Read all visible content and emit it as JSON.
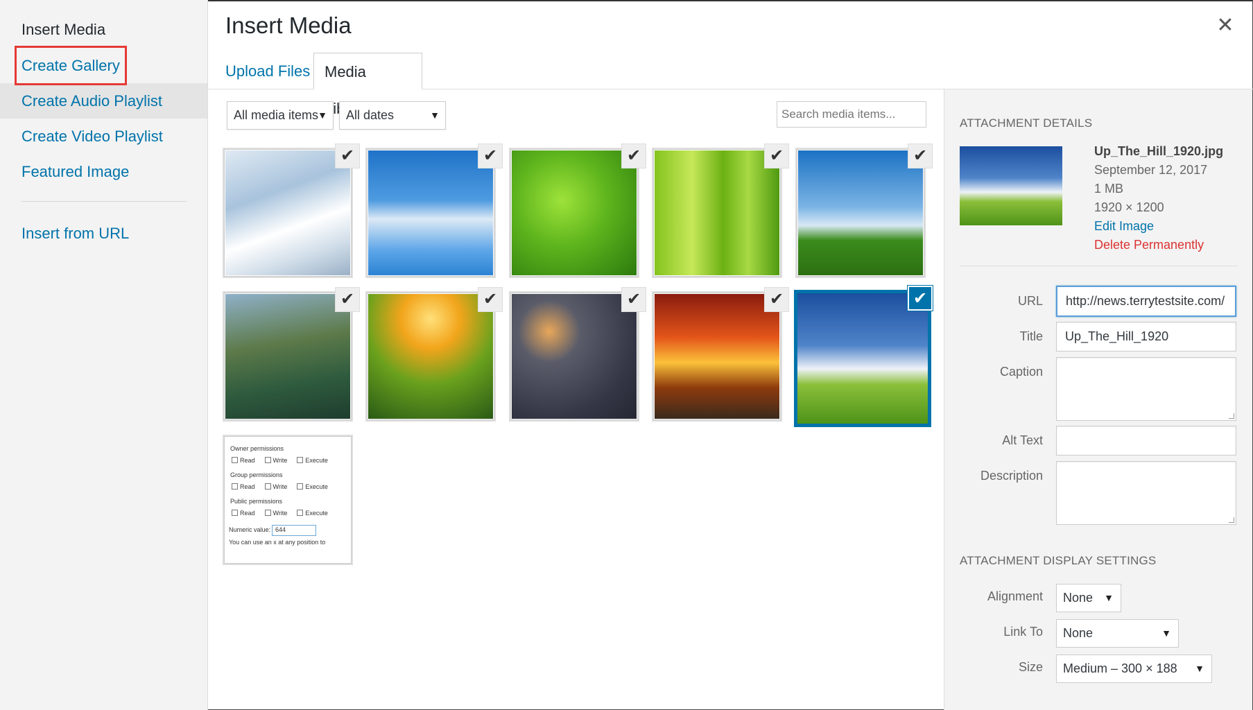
{
  "menu": {
    "title": "Insert Media",
    "items": [
      {
        "label": "Create Gallery"
      },
      {
        "label": "Create Audio Playlist"
      },
      {
        "label": "Create Video Playlist"
      },
      {
        "label": "Featured Image"
      },
      {
        "label": "Insert from URL"
      }
    ]
  },
  "header": {
    "title": "Insert Media",
    "close_icon": "close-icon",
    "tabs": [
      {
        "label": "Upload Files",
        "active": false
      },
      {
        "label": "Media Library",
        "active": true
      }
    ]
  },
  "toolbar": {
    "media_filter": "All media items",
    "date_filter": "All dates",
    "search_placeholder": "Search media items..."
  },
  "library": {
    "items": [
      {
        "subject": "snowy trees",
        "checked": true,
        "selected": false
      },
      {
        "subject": "icicles",
        "checked": true,
        "selected": false
      },
      {
        "subject": "leaf water drops",
        "checked": true,
        "selected": false
      },
      {
        "subject": "green stripes drops",
        "checked": true,
        "selected": false
      },
      {
        "subject": "hot air balloon tree",
        "checked": true,
        "selected": false
      },
      {
        "subject": "mountain",
        "checked": true,
        "selected": false
      },
      {
        "subject": "sunlit forest",
        "checked": true,
        "selected": false
      },
      {
        "subject": "string lights bokeh",
        "checked": true,
        "selected": false
      },
      {
        "subject": "fiery sunset",
        "checked": true,
        "selected": false
      },
      {
        "subject": "up the hill field",
        "checked": true,
        "selected": true
      },
      {
        "subject": "permissions screenshot",
        "checked": false,
        "selected": false
      }
    ],
    "permissions_thumb": {
      "owner": "Owner permissions",
      "group": "Group permissions",
      "public": "Public permissions",
      "read": "Read",
      "write": "Write",
      "execute": "Execute",
      "numeric_label": "Numeric value:",
      "numeric_value": "644",
      "note": "You can use an x at any position to"
    }
  },
  "attachment": {
    "heading": "ATTACHMENT DETAILS",
    "filename": "Up_The_Hill_1920.jpg",
    "date": "September 12, 2017",
    "filesize": "1 MB",
    "dimensions": "1920 × 1200",
    "edit_link": "Edit Image",
    "delete_link": "Delete Permanently",
    "fields": {
      "url_label": "URL",
      "url_value": "http://news.terrytestsite.com/",
      "title_label": "Title",
      "title_value": "Up_The_Hill_1920",
      "caption_label": "Caption",
      "caption_value": "",
      "alt_label": "Alt Text",
      "alt_value": "",
      "description_label": "Description",
      "description_value": ""
    }
  },
  "display_settings": {
    "heading": "ATTACHMENT DISPLAY SETTINGS",
    "alignment_label": "Alignment",
    "alignment_value": "None",
    "link_label": "Link To",
    "link_value": "None",
    "size_label": "Size",
    "size_value": "Medium – 300 × 188"
  },
  "colors": {
    "accent": "#0073aa",
    "danger": "#dc3232",
    "highlight_box": "#e53935"
  }
}
